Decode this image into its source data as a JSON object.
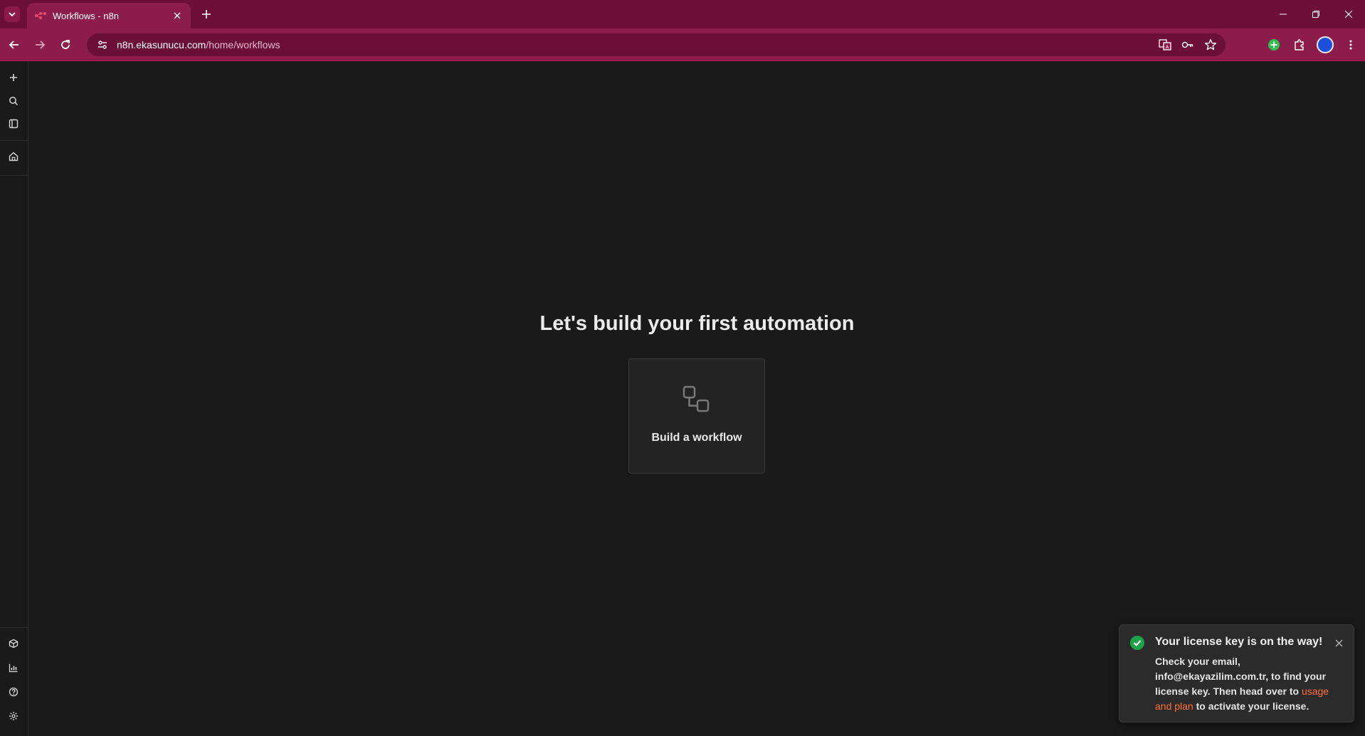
{
  "browser": {
    "tab": {
      "title": "Workflows - n8n"
    },
    "address": {
      "host": "n8n.ekasunucu.com",
      "path": "/home/workflows"
    }
  },
  "main": {
    "heading": "Let's build your first automation",
    "build_card": {
      "label": "Build a workflow"
    }
  },
  "toast": {
    "title": "Your license key is on the way!",
    "body_prefix": "Check your email, info@ekayazilim.com.tr, to find your license key. Then head over to ",
    "link": "usage and plan",
    "body_suffix": " to activate your license."
  },
  "colors": {
    "tabstrip": "#6b0f36",
    "toolbar": "#8c1d4a",
    "background": "#1a1a1a",
    "accent_link": "#ff6f3c",
    "success": "#1fa34a"
  }
}
